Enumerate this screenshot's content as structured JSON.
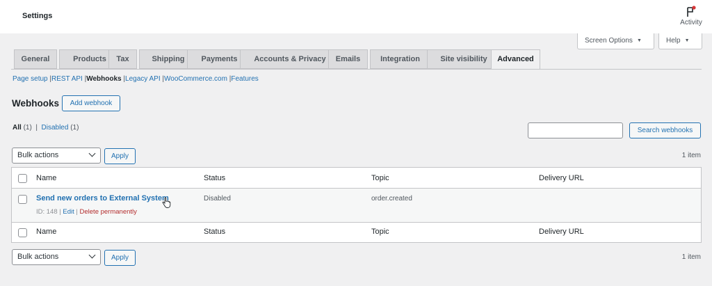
{
  "header": {
    "title": "Settings",
    "activity_label": "Activity"
  },
  "screen_meta": {
    "screen_options_label": "Screen Options",
    "help_label": "Help"
  },
  "tabs": [
    {
      "label": "General"
    },
    {
      "label": "Products"
    },
    {
      "label": "Tax"
    },
    {
      "label": "Shipping"
    },
    {
      "label": "Payments"
    },
    {
      "label": "Accounts & Privacy"
    },
    {
      "label": "Emails"
    },
    {
      "label": "Integration"
    },
    {
      "label": "Site visibility"
    },
    {
      "label": "Advanced",
      "active": true
    }
  ],
  "subnav": [
    {
      "label": "Page setup"
    },
    {
      "label": "REST API"
    },
    {
      "label": "Webhooks",
      "current": true
    },
    {
      "label": "Legacy API"
    },
    {
      "label": "WooCommerce.com"
    },
    {
      "label": "Features"
    }
  ],
  "page": {
    "title": "Webhooks",
    "add_button_label": "Add webhook"
  },
  "filters": {
    "all_label": "All",
    "all_count": "(1)",
    "disabled_label": "Disabled",
    "disabled_count": "(1)"
  },
  "search": {
    "value": "",
    "button_label": "Search webhooks"
  },
  "bulk": {
    "select_value": "Bulk actions",
    "apply_label": "Apply",
    "items_count": "1 item"
  },
  "table": {
    "columns": [
      "Name",
      "Status",
      "Topic",
      "Delivery URL"
    ],
    "rows": [
      {
        "name": "Send new orders to External System",
        "id_text": "ID: 148",
        "edit_label": "Edit",
        "delete_label": "Delete permanently",
        "status": "Disabled",
        "topic": "order.created",
        "delivery_url": ""
      }
    ]
  },
  "colors": {
    "accent": "#2271b1",
    "danger": "#b32d2e",
    "badge_dot": "#d63638"
  }
}
